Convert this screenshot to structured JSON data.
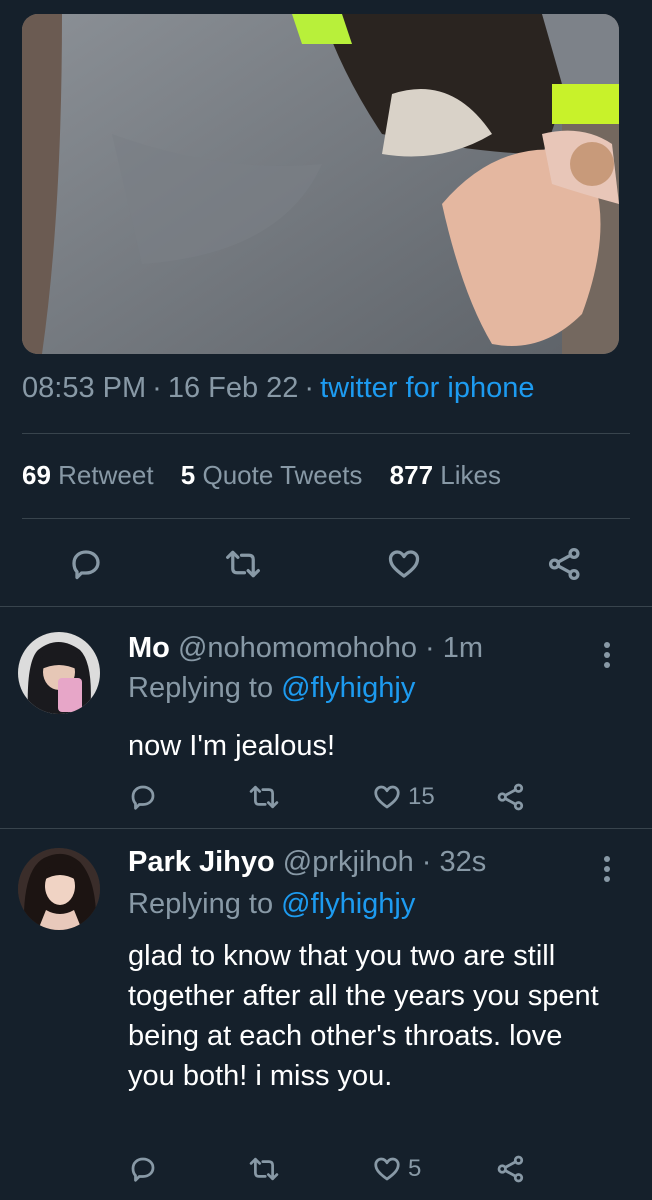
{
  "tweet": {
    "time": "08:53 PM",
    "date": "16 Feb 22",
    "source": "twitter for iphone",
    "stats": {
      "retweets_count": "69",
      "retweets_label": "Retweet",
      "quotes_count": "5",
      "quotes_label": "Quote Tweets",
      "likes_count": "877",
      "likes_label": "Likes"
    }
  },
  "replies": [
    {
      "name": "Mo",
      "handle": "@nohomomohoho",
      "time": "1m",
      "replying_label": "Replying to",
      "replying_to": "@flyhighjy",
      "text": "now I'm jealous!",
      "likes": "15"
    },
    {
      "name": "Park Jihyo",
      "handle": "@prkjihoh",
      "time": "32s",
      "replying_label": "Replying to",
      "replying_to": "@flyhighjy",
      "text": "glad to know that you two are still together after all the years you spent being at each other's throats. love you both! i miss you.",
      "likes": "5"
    }
  ],
  "icons": {
    "reply": "reply-icon",
    "retweet": "retweet-icon",
    "like": "heart-icon",
    "share": "share-icon",
    "more": "more-vertical-icon"
  },
  "colors": {
    "background": "#15202b",
    "secondary_text": "#8899a6",
    "link": "#1d9bf0",
    "divider": "#38444d"
  }
}
